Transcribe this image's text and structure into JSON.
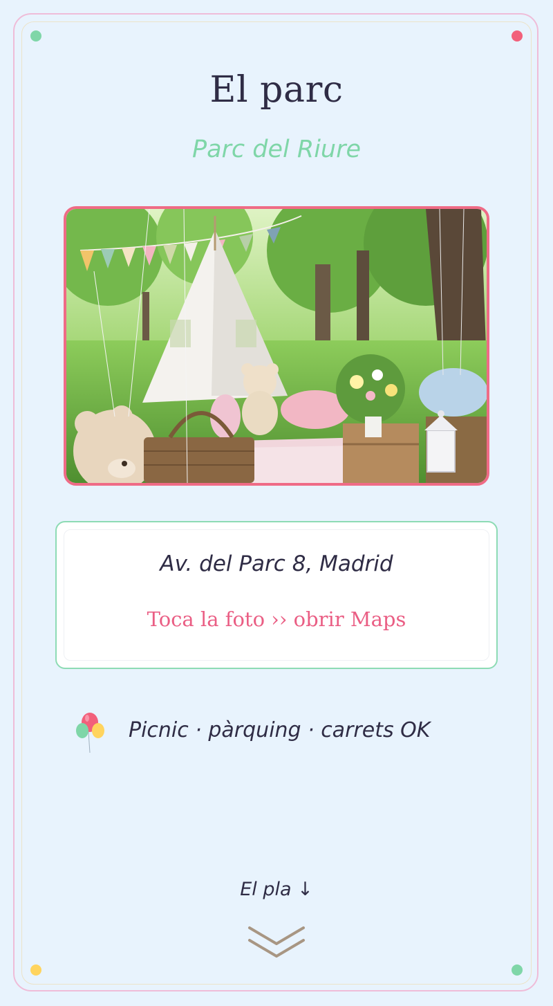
{
  "section": {
    "title": "El parc",
    "subtitle": "Parc del Riure"
  },
  "location": {
    "address": "Av. del Parc 8, Madrid",
    "maps_hint": "Toca la foto ›› obrir Maps"
  },
  "features_text": "Picnic · pàrquing · carrets OK",
  "next_section": {
    "label": "El pla ↓"
  },
  "icons": {
    "corner_dots": "dot-icon",
    "balloons": "balloons-icon",
    "scroll": "double-chevron-down-icon"
  },
  "colors": {
    "background": "#e8f3fd",
    "accent_pink": "#ef6b86",
    "accent_green": "#7fd6a8",
    "accent_yellow": "#ffd45e",
    "text_dark": "#2f2c45",
    "subtitle_green": "#7fd6a8"
  }
}
